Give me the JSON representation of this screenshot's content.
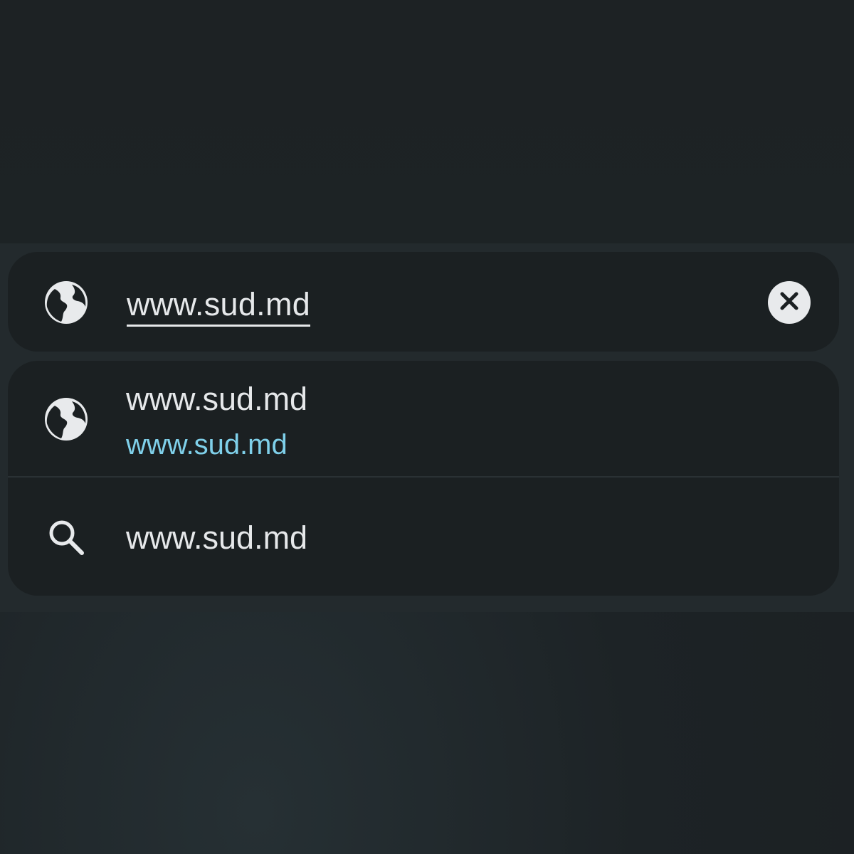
{
  "omnibox": {
    "url_text": "www.sud.md",
    "leading_icon": "globe-icon",
    "clear_icon": "close-icon"
  },
  "suggestions": [
    {
      "icon": "globe-icon",
      "title": "www.sud.md",
      "url": "www.sud.md"
    },
    {
      "icon": "search-icon",
      "title": "www.sud.md"
    }
  ],
  "colors": {
    "background": "#1d2326",
    "panel": "#232a2d",
    "card": "#1b2022",
    "text": "#e6e8ea",
    "link": "#7fd0ea",
    "icon": "#e8eaec"
  }
}
